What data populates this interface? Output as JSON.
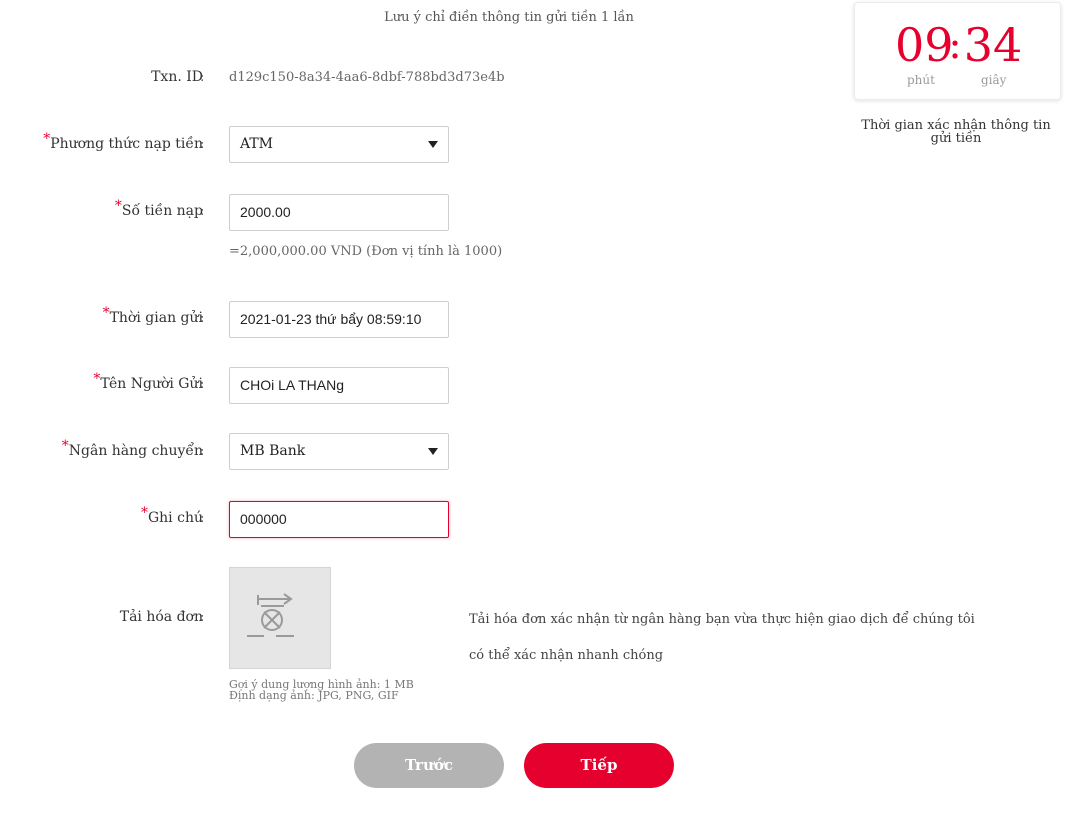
{
  "notice": "Lưu ý chỉ điền thông tin gửi tiền 1 lần",
  "timer": {
    "minutes": "09",
    "separator": ":",
    "seconds": "34",
    "minutes_label": "phút",
    "seconds_label": "giây",
    "caption": "Thời gian xác nhận thông tin gửi tiền"
  },
  "colon": ":",
  "required_mark": "*",
  "form": {
    "txn": {
      "label": "Txn. ID",
      "value": "d129c150-8a34-4aa6-8dbf-788bd3d73e4b"
    },
    "method": {
      "label": "Phương thức nạp tiền",
      "value": "ATM"
    },
    "amount": {
      "label": "Số tiền nạp",
      "value": "2000.00",
      "hint": "=2,000,000.00 VND (Đơn vị tính là 1000)"
    },
    "time": {
      "label": "Thời gian gửi",
      "value": "2021-01-23 thứ bẩy 08:59:10"
    },
    "sender": {
      "label": "Tên Người Gửi",
      "value": "CHOi LA THANg"
    },
    "bank": {
      "label": "Ngân hàng chuyển",
      "value": "MB Bank"
    },
    "note": {
      "label": "Ghi chú",
      "value": "000000"
    },
    "receipt": {
      "label": "Tải hóa đơn",
      "hint_size": "Gợi ý dung lượng hình ảnh: 1 MB",
      "hint_format": "Định dạng ảnh: JPG, PNG, GIF",
      "description": "Tải hóa đơn xác nhận từ ngân hàng bạn vừa thực hiện giao dịch để chúng tôi có thể xác nhận nhanh chóng"
    }
  },
  "buttons": {
    "prev": "Trước",
    "next": "Tiếp"
  },
  "colors": {
    "accent": "#e5002e",
    "disabled": "#b3b3b3"
  }
}
